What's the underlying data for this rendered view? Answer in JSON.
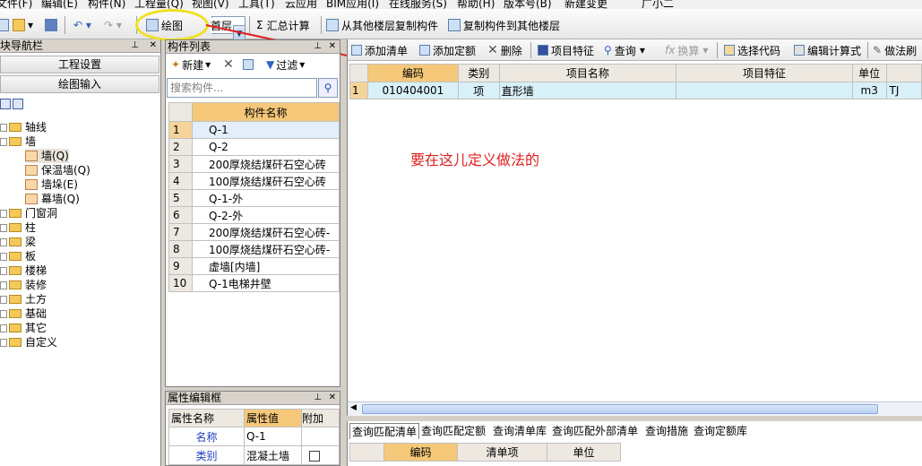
{
  "menubar": {
    "items": [
      "文件(F)",
      "编辑(E)",
      "构件(N)",
      "工程量(Q)",
      "视图(V)",
      "工具(T)",
      "云应用",
      "BIM应用(I)",
      "在线服务(S)",
      "帮助(H)",
      "版本号(B)",
      "新建变更",
      "广小二"
    ]
  },
  "toolbar": {
    "draw_label": "绘图",
    "floor_value": "首层",
    "summary_label": "汇总计算",
    "copy_from_label": "从其他楼层复制构件",
    "copy_to_label": "复制构件到其他楼层"
  },
  "nav": {
    "title": "模块导航栏",
    "btn_project": "工程设置",
    "btn_draw": "绘图输入",
    "tree": [
      {
        "label": "轴线",
        "level": 0
      },
      {
        "label": "墙",
        "level": 0
      },
      {
        "label": "墙(Q)",
        "level": 1
      },
      {
        "label": "保温墙(Q)",
        "level": 1
      },
      {
        "label": "墙垛(E)",
        "level": 1
      },
      {
        "label": "幕墙(Q)",
        "level": 1
      },
      {
        "label": "门窗洞",
        "level": 0
      },
      {
        "label": "柱",
        "level": 0
      },
      {
        "label": "梁",
        "level": 0
      },
      {
        "label": "板",
        "level": 0
      },
      {
        "label": "楼梯",
        "level": 0
      },
      {
        "label": "装修",
        "level": 0
      },
      {
        "label": "土方",
        "level": 0
      },
      {
        "label": "基础",
        "level": 0
      },
      {
        "label": "其它",
        "level": 0
      },
      {
        "label": "自定义",
        "level": 0
      }
    ]
  },
  "clist": {
    "title": "构件列表",
    "new_label": "新建",
    "filter_label": "过滤",
    "search_placeholder": "搜索构件...",
    "header": "构件名称",
    "rows": [
      {
        "no": "1",
        "name": "Q-1"
      },
      {
        "no": "2",
        "name": "Q-2"
      },
      {
        "no": "3",
        "name": "200厚烧结煤矸石空心砖"
      },
      {
        "no": "4",
        "name": "100厚烧结煤矸石空心砖"
      },
      {
        "no": "5",
        "name": "Q-1-外"
      },
      {
        "no": "6",
        "name": "Q-2-外"
      },
      {
        "no": "7",
        "name": "200厚烧结煤矸石空心砖-"
      },
      {
        "no": "8",
        "name": "100厚烧结煤矸石空心砖-"
      },
      {
        "no": "9",
        "name": "虚墙[内墙]"
      },
      {
        "no": "10",
        "name": "Q-1电梯井壁"
      }
    ]
  },
  "prop": {
    "title": "属性编辑框",
    "h_name": "属性名称",
    "h_value": "属性值",
    "h_extra": "附加",
    "rows": [
      {
        "name": "名称",
        "value": "Q-1"
      },
      {
        "name": "类别",
        "value": "混凝土墙"
      }
    ]
  },
  "main": {
    "toolbar": {
      "add_list": "添加清单",
      "add_quota": "添加定额",
      "delete": "删除",
      "item_feature": "项目特征",
      "query": "查询",
      "convert": "换算",
      "select_code": "选择代码",
      "edit_formula": "编辑计算式",
      "method_brush": "做法刷"
    },
    "headers": [
      "编码",
      "类别",
      "项目名称",
      "项目特征",
      "单位",
      ""
    ],
    "rows": [
      {
        "no": "1",
        "code": "010404001",
        "type": "项",
        "name": "直形墙",
        "feature": "",
        "unit": "m3",
        "expr": "TJ"
      }
    ],
    "annotation": "要在这儿定义做法的"
  },
  "bottom": {
    "tabs": [
      "查询匹配清单",
      "查询匹配定额",
      "查询清单库",
      "查询匹配外部清单",
      "查询措施",
      "查询定额库"
    ],
    "headers": [
      "编码",
      "清单项",
      "单位"
    ]
  },
  "colors": {
    "header": "#f5c87a",
    "selected_row": "#d8f0f8",
    "annotation": "#e02020",
    "highlight_circle": "#f0e020"
  }
}
